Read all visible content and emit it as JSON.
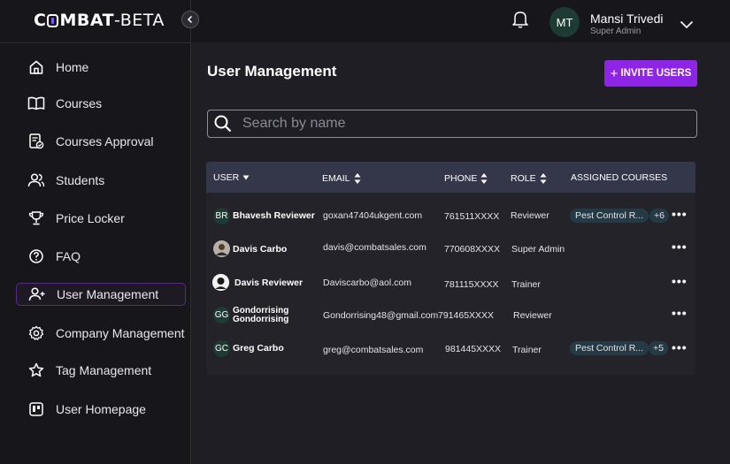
{
  "app": {
    "logo_prefix": "C",
    "logo_middle": "MBAT",
    "logo_suffix": "-BETA"
  },
  "topbar": {
    "user_initials": "MT",
    "user_name": "Mansi Trivedi",
    "user_role": "Super Admin"
  },
  "sidebar": {
    "items": [
      {
        "label": "Home",
        "icon": "home-icon"
      },
      {
        "label": "Courses",
        "icon": "book-icon"
      },
      {
        "label": "Courses Approval",
        "icon": "approval-icon"
      },
      {
        "label": "Students",
        "icon": "students-icon"
      },
      {
        "label": "Price Locker",
        "icon": "trophy-icon"
      },
      {
        "label": "FAQ",
        "icon": "question-icon"
      },
      {
        "label": "User Management",
        "icon": "user-add-icon",
        "active": true
      },
      {
        "label": "Company Management",
        "icon": "settings-icon"
      },
      {
        "label": "Tag Management",
        "icon": "star-icon"
      },
      {
        "label": "User Homepage",
        "icon": "homepage-icon"
      }
    ]
  },
  "main": {
    "title": "User Management",
    "invite_label": "INVITE USERS",
    "invite_plus": "+",
    "search_placeholder": "Search by name",
    "accent_color": "#8e24e6"
  },
  "table": {
    "headers": {
      "user": "USER",
      "email": "EMAIL",
      "phone": "PHONE",
      "role": "ROLE",
      "courses": "ASSIGNED COURSES"
    },
    "rows": [
      {
        "initials": "BR",
        "name": "Bhavesh Reviewer",
        "email": "goxan47404ukgent.com",
        "phone": "761511XXXX",
        "role": "Reviewer",
        "course": "Pest Control R...",
        "more": "+6"
      },
      {
        "initials": "",
        "name": "Davis Carbo",
        "email": "davis@combatsales.com",
        "phone": "770608XXXX",
        "role": "Super Admin",
        "course": "",
        "more": ""
      },
      {
        "initials": "",
        "name": "Davis Reviewer",
        "email": "Daviscarbo@aol.com",
        "phone": "781115XXXX",
        "role": "Trainer",
        "course": "",
        "more": ""
      },
      {
        "initials": "GG",
        "name_line1": "Gondorrising",
        "name_line2": "Gondorrising",
        "email": "Gondorrising48@gmail.com",
        "phone": "791465XXXX",
        "role": "Reviewer",
        "course": "",
        "more": ""
      },
      {
        "initials": "GC",
        "name": "Greg Carbo",
        "email": "greg@combatsales.com",
        "phone": "981445XXXX",
        "role": "Trainer",
        "course": "Pest Control R...",
        "more": "+5"
      }
    ]
  }
}
